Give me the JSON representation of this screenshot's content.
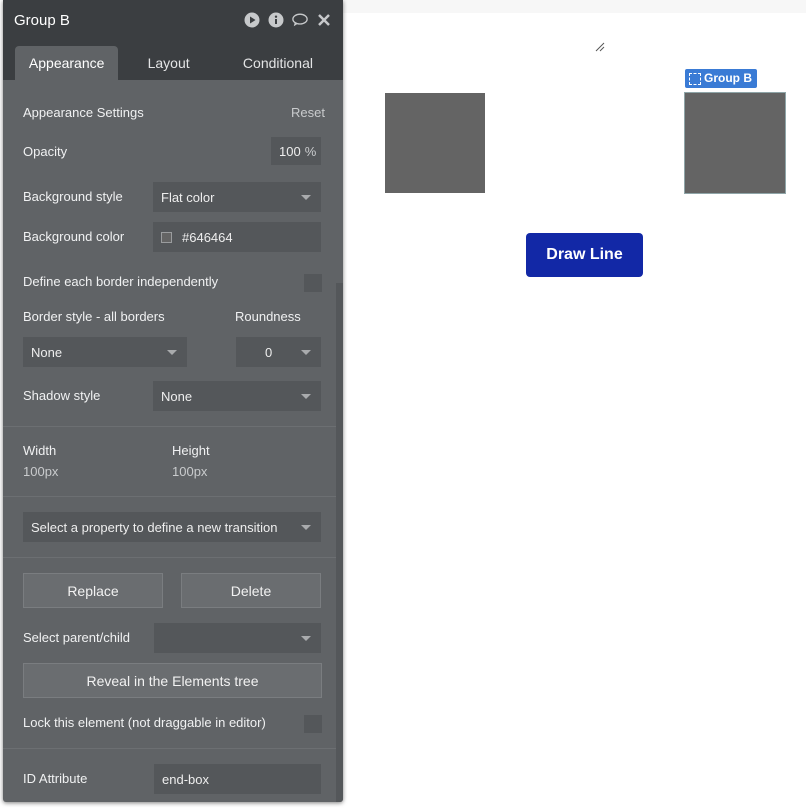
{
  "panel": {
    "title": "Group B",
    "icons": [
      "play-icon",
      "info-icon",
      "comment-icon",
      "close-icon"
    ],
    "tabs": [
      {
        "label": "Appearance",
        "active": true
      },
      {
        "label": "Layout",
        "active": false
      },
      {
        "label": "Conditional",
        "active": false
      }
    ],
    "appearance": {
      "section_title": "Appearance Settings",
      "reset_label": "Reset",
      "opacity_label": "Opacity",
      "opacity_value": "100",
      "opacity_unit": "%",
      "bg_style_label": "Background style",
      "bg_style_value": "Flat color",
      "bg_color_label": "Background color",
      "bg_color_value": "#646464",
      "border_indep_label": "Define each border independently",
      "border_style_label": "Border style - all borders",
      "border_style_value": "None",
      "roundness_label": "Roundness",
      "roundness_value": "0",
      "shadow_label": "Shadow style",
      "shadow_value": "None",
      "width_label": "Width",
      "width_value": "100px",
      "height_label": "Height",
      "height_value": "100px",
      "transition_placeholder": "Select a property to define a new transition"
    },
    "actions": {
      "replace_label": "Replace",
      "delete_label": "Delete",
      "parent_child_label": "Select parent/child",
      "reveal_label": "Reveal in the Elements tree",
      "lock_label": "Lock this element (not draggable in editor)",
      "id_label": "ID Attribute",
      "id_value": "end-box"
    }
  },
  "canvas": {
    "selected_label": "Group B",
    "draw_button_label": "Draw Line",
    "box_color": "#646464",
    "button_color": "#1228a6",
    "selection_color": "#3a7bd5"
  }
}
